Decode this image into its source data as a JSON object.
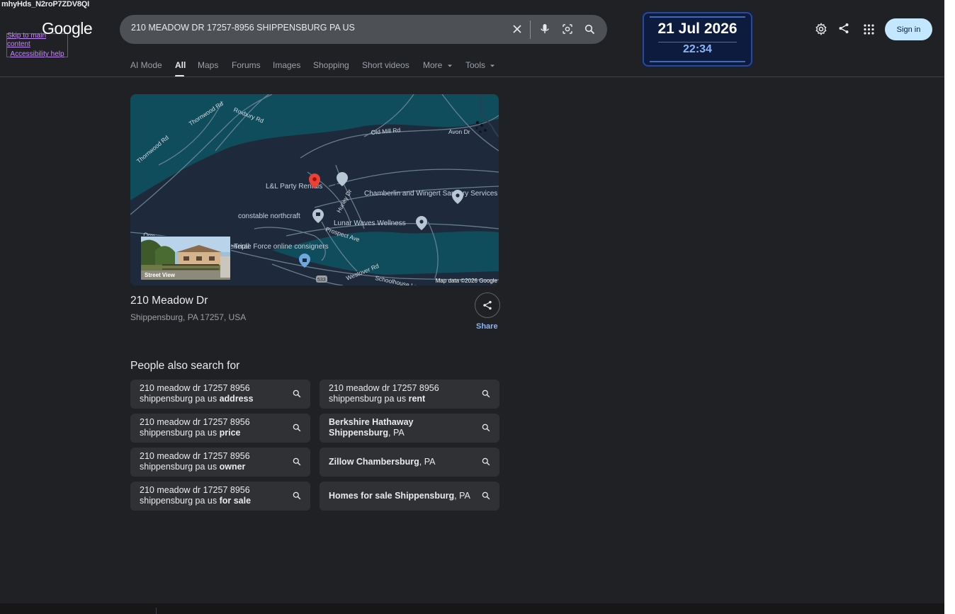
{
  "window": {
    "title_overlay": "mhyHds_N2roP7ZDV8QI",
    "skip_links": [
      "Skip to main content",
      "Accessibility help"
    ]
  },
  "header": {
    "logo": "Google",
    "search": {
      "query": "210 MEADOW DR 17257-8956 SHIPPENSBURG PA US",
      "icons": [
        "close-icon",
        "microphone-icon",
        "lens-icon",
        "search-icon"
      ]
    },
    "clock": {
      "date": "21 Jul 2026",
      "time": "22:34"
    },
    "actions": {
      "settings_icon": "gear-icon",
      "share_icon": "share-icon",
      "apps_icon": "apps-grid-icon",
      "sign_in": "Sign in"
    },
    "signin_color": "#c2e7ff"
  },
  "tabs": [
    {
      "label": "AI Mode",
      "active": false
    },
    {
      "label": "All",
      "active": true
    },
    {
      "label": "Maps",
      "active": false
    },
    {
      "label": "Forums",
      "active": false
    },
    {
      "label": "Images",
      "active": false
    },
    {
      "label": "Shopping",
      "active": false
    },
    {
      "label": "Short videos",
      "active": false
    },
    {
      "label": "More",
      "active": false,
      "dropdown": true
    },
    {
      "label": "Tools",
      "active": false,
      "dropdown": true
    }
  ],
  "map": {
    "roads": [
      "Roxbury Rd",
      "Thornwood Rd",
      "Thornwood Rd",
      "Old Mill Rd",
      "Avon Dr",
      "Hurley Dr",
      "Prospect Ave",
      "Westover Rd",
      "Schoolhouse Ln",
      "Orrs",
      "533"
    ],
    "pois": [
      "L&L Party Rentals",
      "Chamberlin and Wingert Sanitary Services",
      "constable northcraft",
      "Lunar Waves Wellness",
      "Triple Force online consigners",
      "eneral"
    ],
    "street_view_label": "Street View",
    "credit": "Map data ©2026 Google",
    "water_color": "#0f4c5c",
    "land_color": "#1e2a3b"
  },
  "place": {
    "title": "210 Meadow Dr",
    "subtitle": "Shippensburg, PA 17257, USA",
    "share_label": "Share"
  },
  "people_also_search": {
    "title": "People also search for",
    "chips": [
      {
        "plain": "210 meadow dr 17257 8956 shippensburg pa us ",
        "bold": "address"
      },
      {
        "plain": "210 meadow dr 17257 8956 shippensburg pa us ",
        "bold": "rent"
      },
      {
        "plain": "210 meadow dr 17257 8956 shippensburg pa us ",
        "bold": "price"
      },
      {
        "plain": "",
        "bold": "Berkshire Hathaway Shippensburg",
        "tail": ", PA"
      },
      {
        "plain": "210 meadow dr 17257 8956 shippensburg pa us ",
        "bold": "owner"
      },
      {
        "plain": "",
        "bold": "Zillow Chambersburg",
        "tail": ", PA"
      },
      {
        "plain": "210 meadow dr 17257 8956 shippensburg pa us ",
        "bold": "for sale"
      },
      {
        "plain": "",
        "bold": "Homes for sale Shippensburg",
        "tail": ", PA"
      }
    ]
  }
}
